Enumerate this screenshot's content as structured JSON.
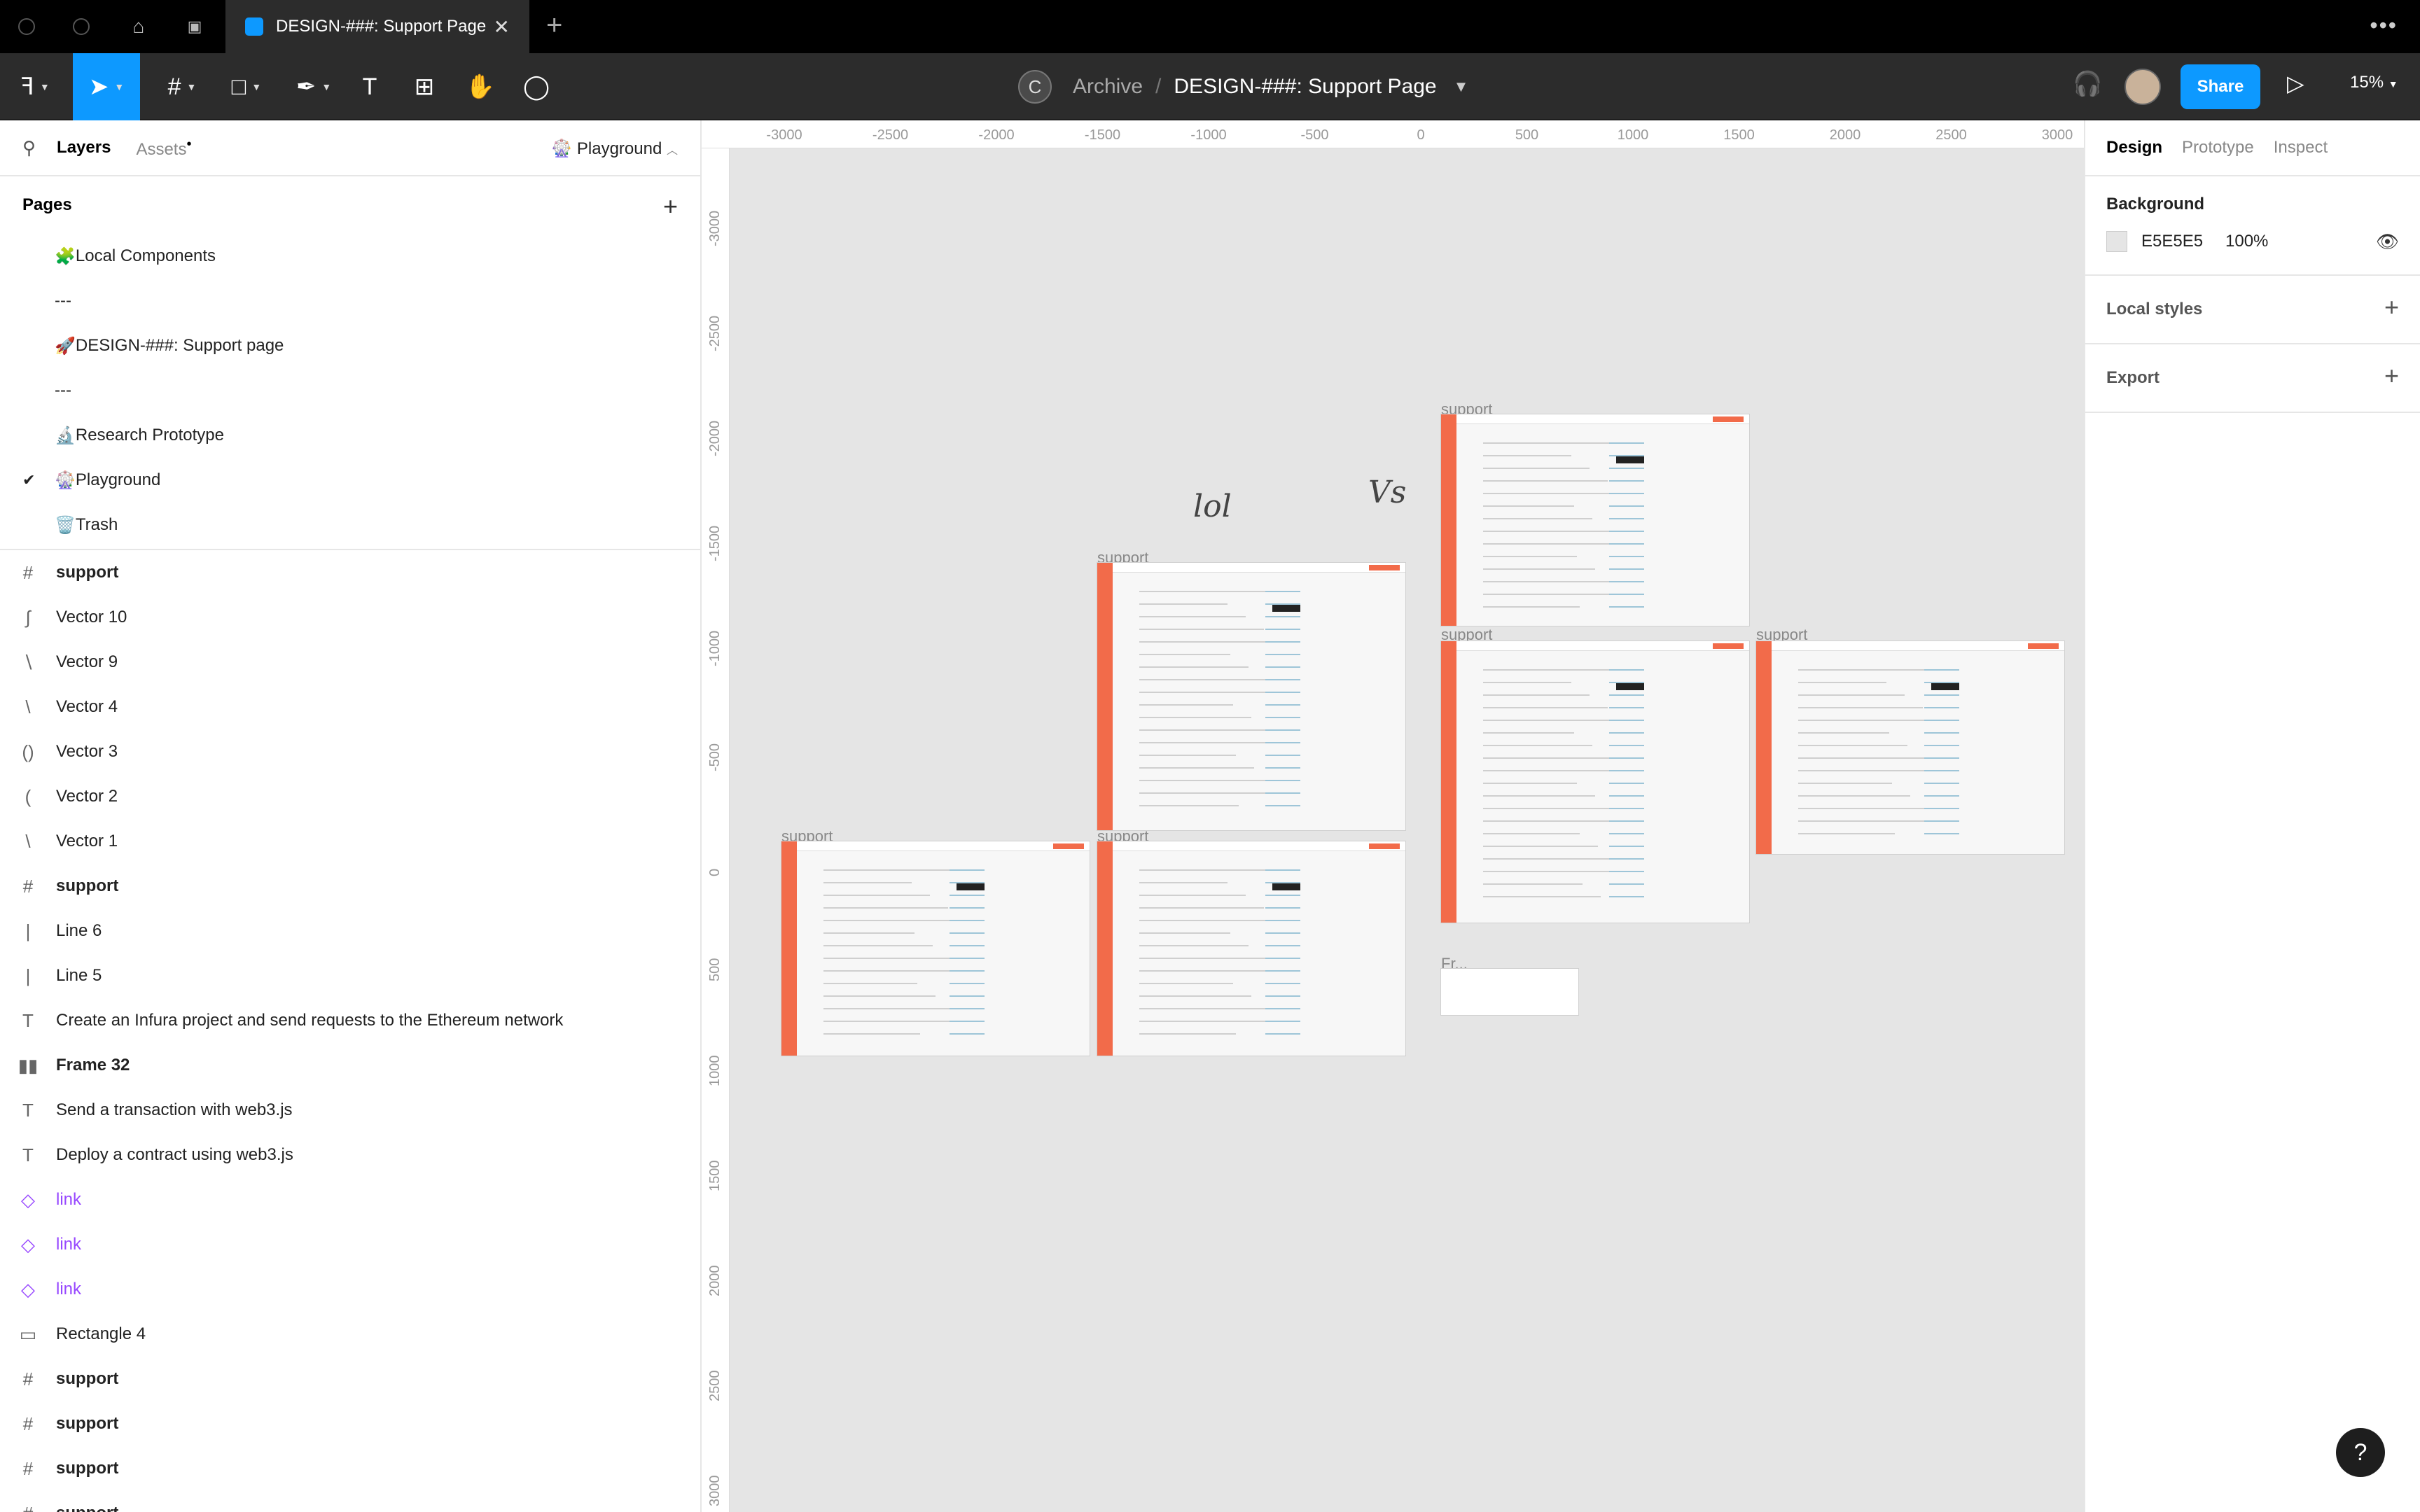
{
  "tabs": {
    "active_title": "DESIGN-###: Support Page"
  },
  "toolbar": {
    "team_initial": "C",
    "project": "Archive",
    "separator": "/",
    "file_name": "DESIGN-###: Support Page",
    "share_label": "Share",
    "zoom": "15%"
  },
  "left_panel": {
    "tab_layers": "Layers",
    "tab_assets": "Assets",
    "current_page": "Playground",
    "pages_header": "Pages",
    "pages": [
      {
        "label": "Local Components",
        "emoji": "🧩"
      },
      {
        "label": "---",
        "emoji": ""
      },
      {
        "label": "DESIGN-###: Support page",
        "emoji": "🚀"
      },
      {
        "label": "---",
        "emoji": ""
      },
      {
        "label": "Research Prototype",
        "emoji": "🔬"
      },
      {
        "label": "Playground",
        "emoji": "🎡",
        "selected": true
      },
      {
        "label": "Trash",
        "emoji": "🗑️"
      }
    ],
    "layers": [
      {
        "name": "support",
        "icon": "frame-icon",
        "glyph": "#",
        "kind": "frame"
      },
      {
        "name": "Vector 10",
        "icon": "vector-icon",
        "glyph": "∫",
        "kind": "vector"
      },
      {
        "name": "Vector 9",
        "icon": "vector-icon",
        "glyph": "∖",
        "kind": "vector"
      },
      {
        "name": "Vector 4",
        "icon": "vector-icon",
        "glyph": "\\",
        "kind": "vector"
      },
      {
        "name": "Vector 3",
        "icon": "vector-icon",
        "glyph": "()",
        "kind": "vector"
      },
      {
        "name": "Vector 2",
        "icon": "vector-icon",
        "glyph": "(",
        "kind": "vector"
      },
      {
        "name": "Vector 1",
        "icon": "vector-icon",
        "glyph": "\\",
        "kind": "vector"
      },
      {
        "name": "support",
        "icon": "frame-icon",
        "glyph": "#",
        "kind": "frame"
      },
      {
        "name": "Line 6",
        "icon": "line-icon",
        "glyph": "|",
        "kind": "line"
      },
      {
        "name": "Line 5",
        "icon": "line-icon",
        "glyph": "|",
        "kind": "line"
      },
      {
        "name": "Create an Infura project and send requests to the Ethereum network",
        "icon": "text-icon",
        "glyph": "T",
        "kind": "text"
      },
      {
        "name": "Frame 32",
        "icon": "auto-layout-icon",
        "glyph": "▮▮",
        "kind": "frame"
      },
      {
        "name": "Send a transaction with web3.js",
        "icon": "text-icon",
        "glyph": "T",
        "kind": "text"
      },
      {
        "name": "Deploy a contract using web3.js",
        "icon": "text-icon",
        "glyph": "T",
        "kind": "text"
      },
      {
        "name": "link",
        "icon": "component-instance-icon",
        "glyph": "◇",
        "kind": "component"
      },
      {
        "name": "link",
        "icon": "component-instance-icon",
        "glyph": "◇",
        "kind": "component"
      },
      {
        "name": "link",
        "icon": "component-instance-icon",
        "glyph": "◇",
        "kind": "component"
      },
      {
        "name": "Rectangle 4",
        "icon": "rectangle-icon",
        "glyph": "▭",
        "kind": "rect"
      },
      {
        "name": "support",
        "icon": "frame-icon",
        "glyph": "#",
        "kind": "frame"
      },
      {
        "name": "support",
        "icon": "frame-icon",
        "glyph": "#",
        "kind": "frame"
      },
      {
        "name": "support",
        "icon": "frame-icon",
        "glyph": "#",
        "kind": "frame"
      },
      {
        "name": "support",
        "icon": "frame-icon",
        "glyph": "#",
        "kind": "frame"
      }
    ]
  },
  "canvas": {
    "ruler_top": [
      "-3000",
      "-2500",
      "-2000",
      "-1500",
      "-1000",
      "-500",
      "0",
      "500",
      "1000",
      "1500",
      "2000",
      "2500",
      "3000"
    ],
    "ruler_left": [
      "-3000",
      "-2500",
      "-2000",
      "-1500",
      "-1000",
      "-500",
      "0",
      "500",
      "1000",
      "1500",
      "2000",
      "2500",
      "3000"
    ],
    "frame_label": "support",
    "small_frame_label": "Fr...",
    "handwriting_1": "lol",
    "handwriting_2": "Vs",
    "accent": "#F26B4A"
  },
  "right_panel": {
    "tab_design": "Design",
    "tab_prototype": "Prototype",
    "tab_inspect": "Inspect",
    "background_header": "Background",
    "background_hex": "E5E5E5",
    "background_opacity": "100%",
    "local_styles": "Local styles",
    "export": "Export"
  },
  "help_label": "?"
}
